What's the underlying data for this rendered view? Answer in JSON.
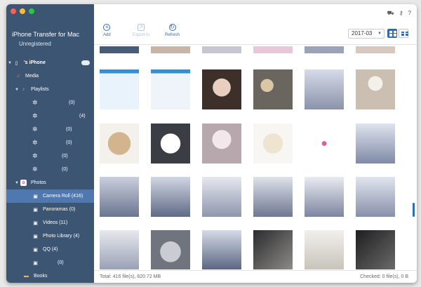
{
  "app": {
    "title": "iPhone Transfer for Mac",
    "subtitle": "Unregistered"
  },
  "sidebar": {
    "device": "'s iPhone",
    "media": "Media",
    "playlists": "Playlists",
    "playlist_counts": [
      "(0)",
      "(4)",
      "(0)",
      "(0)",
      "(0)",
      "(0)"
    ],
    "photos": "Photos",
    "photo_items": [
      {
        "label": "Camera Roll (416)",
        "active": true
      },
      {
        "label": "Panoramas (0)",
        "active": false
      },
      {
        "label": "Videos (11)",
        "active": false
      },
      {
        "label": "Photo Library (4)",
        "active": false
      },
      {
        "label": "QQ (4)",
        "active": false
      }
    ],
    "last_count": "(0)",
    "books": "Books"
  },
  "toolbar": {
    "add": "Add",
    "export": "Export to",
    "refresh": "Refresh",
    "date_value": "2017-03"
  },
  "status": {
    "total": "Total: 416 file(s), 820.72 MB",
    "checked": "Checked: 0 file(s), 0 B"
  },
  "icons": {
    "window_controls": [
      "close-icon",
      "minimize-icon",
      "zoom-icon"
    ],
    "titlebar": [
      "cart-icon",
      "key-icon",
      "question-icon"
    ]
  },
  "colors": {
    "sidebar": "#3c5573",
    "active": "#4f78b0",
    "accent": "#2f6db3"
  }
}
